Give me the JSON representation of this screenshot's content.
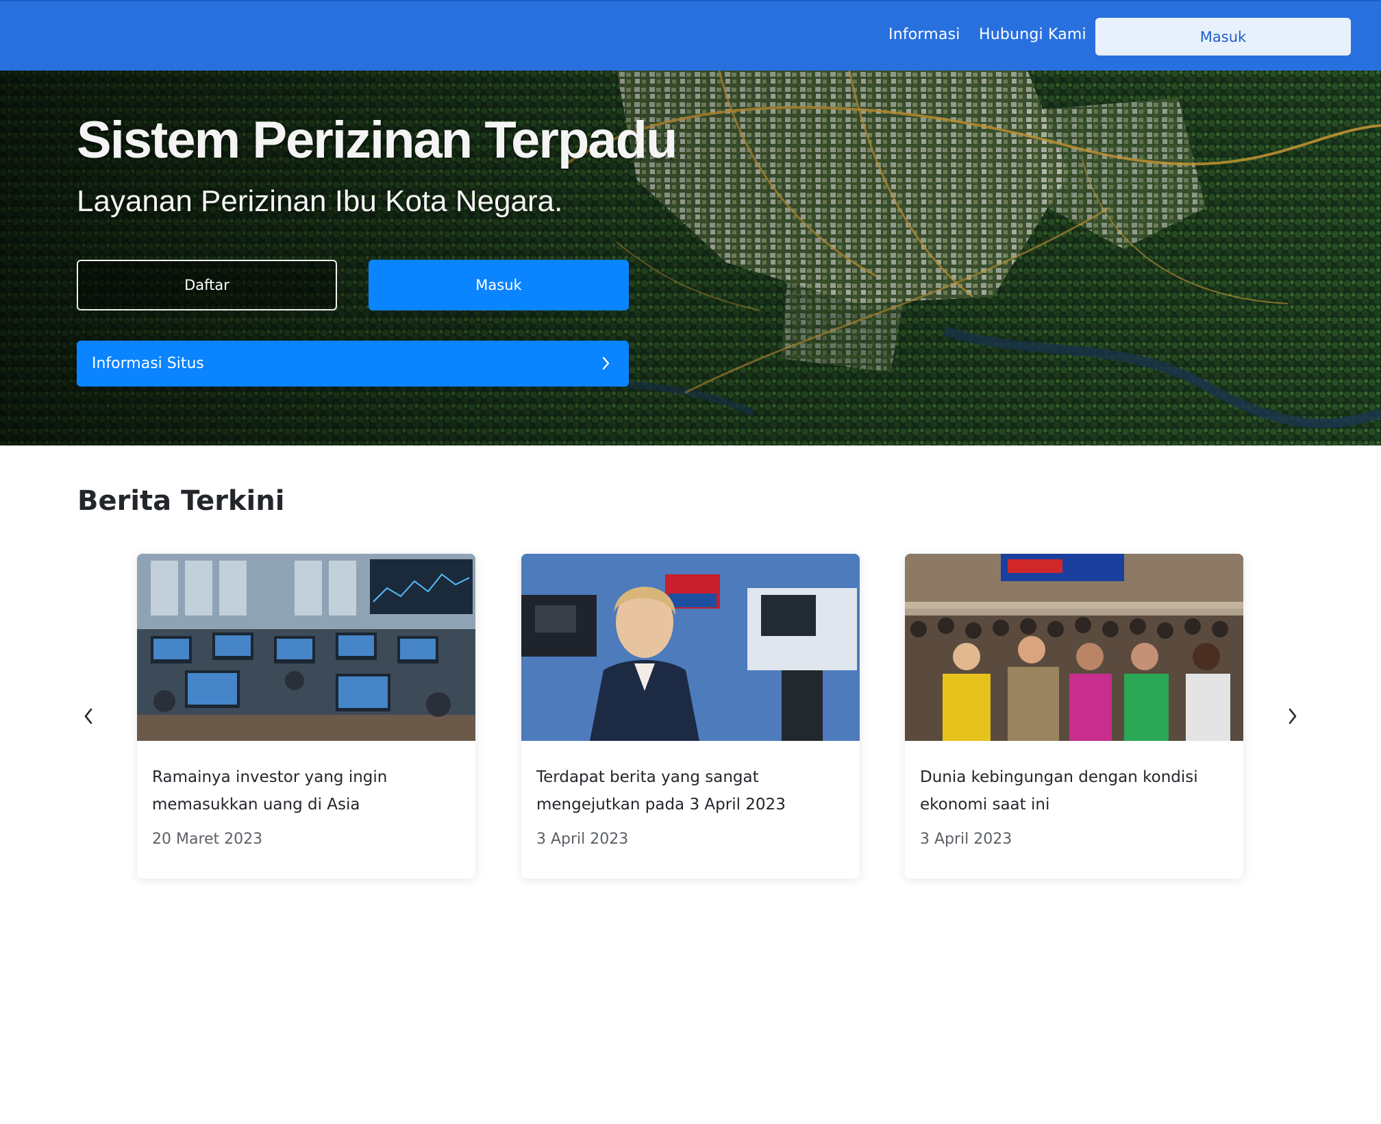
{
  "navbar": {
    "links": [
      "Informasi",
      "Hubungi Kami"
    ],
    "login_label": "Masuk",
    "bg_color": "#2970df"
  },
  "hero": {
    "title": "Sistem Perizinan Terpadu",
    "subtitle": "Layanan Perizinan Ibu Kota Negara.",
    "register_label": "Daftar",
    "login_label": "Masuk",
    "info_label": "Informasi Situs",
    "background": "aerial-city-forest-image",
    "accent": "#0a84ff"
  },
  "news": {
    "title": "Berita Terkini",
    "prev_icon": "chevron-left-icon",
    "next_icon": "chevron-right-icon",
    "items": [
      {
        "headline": "Ramainya investor yang ingin memasukkan uang di Asia",
        "date": "20 Maret 2023",
        "image": "trading-floor-photo"
      },
      {
        "headline": "Terdapat berita yang sangat mengejutkan pada 3 April 2023",
        "date": "3 April 2023",
        "image": "breaking-news-anchor-photo"
      },
      {
        "headline": "Dunia kebingungan dengan kondisi ekonomi saat ini",
        "date": "3 April 2023",
        "image": "crowd-city-square-photo"
      }
    ]
  }
}
